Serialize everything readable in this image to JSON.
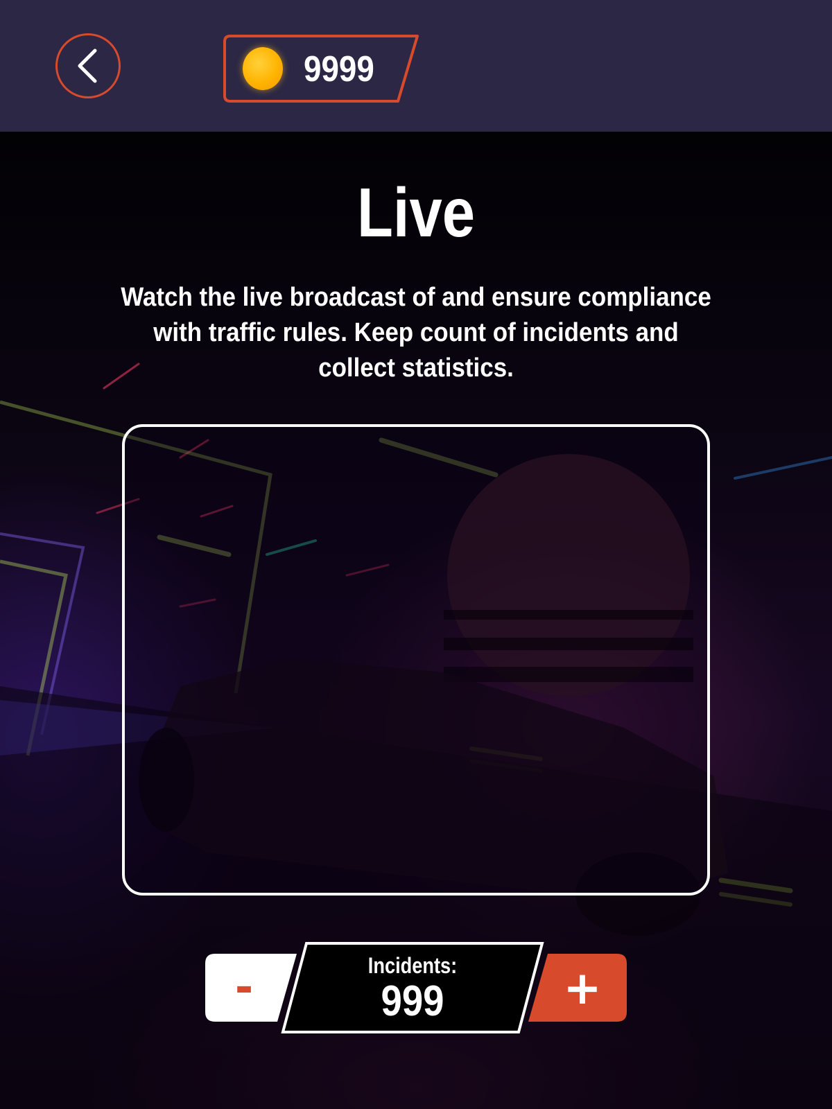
{
  "header": {
    "back_icon": "chevron-left-icon",
    "coin_icon": "coin-icon",
    "coins": "9999"
  },
  "main": {
    "title": "Live",
    "description": "Watch the live broadcast of and ensure compliance with traffic rules. Keep count of incidents and collect statistics."
  },
  "incidents": {
    "label": "Incidents:",
    "value": "999",
    "decrement_label": "-",
    "increment_label": "+"
  },
  "colors": {
    "accent": "#d84a2c",
    "header_bg": "#2b2745",
    "coin": "#ffb300",
    "text": "#ffffff"
  }
}
